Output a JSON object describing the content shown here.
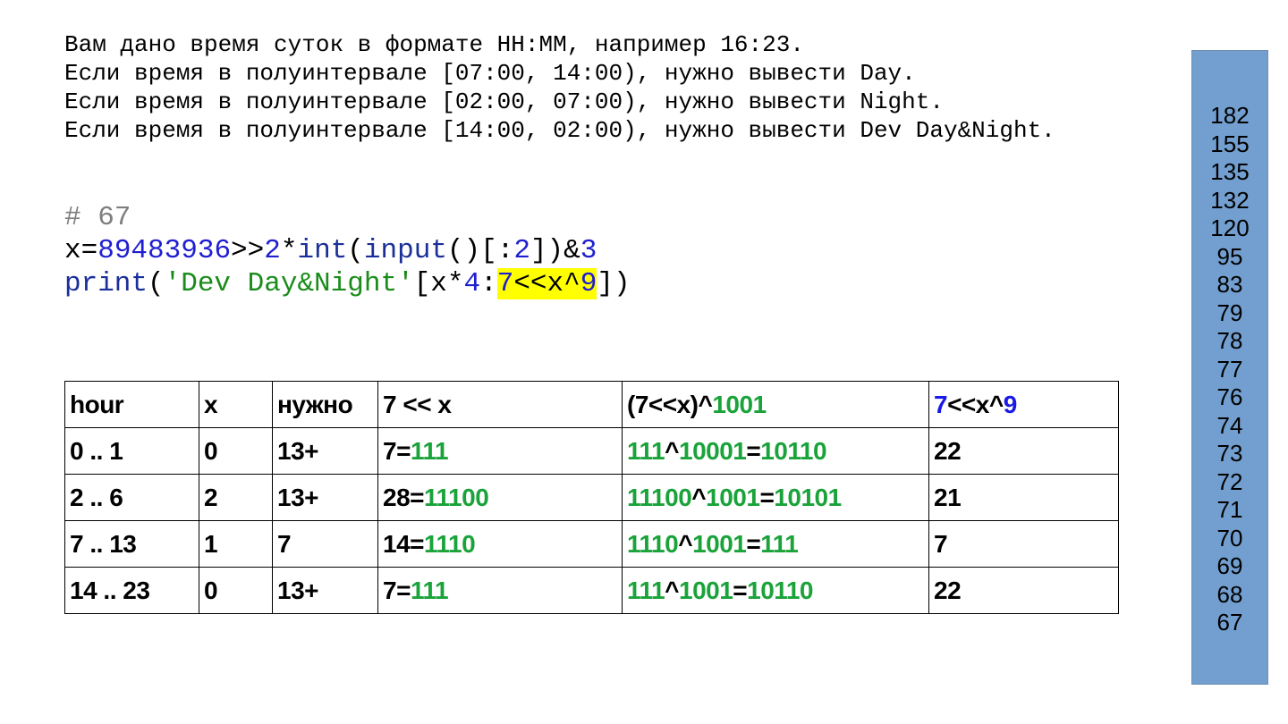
{
  "problem": {
    "lines": [
      "Вам дано время суток в формате HH:MM, например 16:23.",
      "Если время в полуинтервале [07:00, 14:00), нужно вывести Day.",
      "Если время в полуинтервале [02:00, 07:00), нужно вывести Night.",
      "Если время в полуинтервале [14:00, 02:00), нужно вывести Dev Day&Night."
    ]
  },
  "code": {
    "comment": "# 67",
    "line1": {
      "var": "x=",
      "n1": "89483936",
      "op1": ">>",
      "n2": "2",
      "op2": "*",
      "f_int": "int",
      "p1": "(",
      "f_input": "input",
      "p2": "()[:",
      "n3": "2",
      "p3": "])&",
      "n4": "3"
    },
    "line2": {
      "f_print": "print",
      "p1": "(",
      "str": "'Dev Day&Night'",
      "p2": "[x*",
      "n1": "4",
      "p3": ":",
      "hl_n": "7",
      "hl_op": "<<x^",
      "hl_n2": "9",
      "p4": "])"
    }
  },
  "table": {
    "header": {
      "hour": "hour",
      "x": "x",
      "need": "нужно",
      "shift": "7 << x",
      "xor_a": "(7<<x)^",
      "xor_b": "1001",
      "res_a": "7",
      "res_b": "<<x^",
      "res_c": "9"
    },
    "rows": [
      {
        "hour": "0 .. 1",
        "x": "0",
        "need": "13+",
        "dec": "7=",
        "bin": "111",
        "xa": "111",
        "xop": "^",
        "xb": "10001",
        "xeq": "=",
        "xc": "10110",
        "res": "22"
      },
      {
        "hour": "2 .. 6",
        "x": "2",
        "need": "13+",
        "dec": "28=",
        "bin": "11100",
        "xa": "11100",
        "xop": "^",
        "xb": "1001",
        "xeq": "=",
        "xc": "10101",
        "res": "21"
      },
      {
        "hour": "7 .. 13",
        "x": "1",
        "need": "7",
        "dec": "14=",
        "bin": "1110",
        "xa": "1110",
        "xop": "^",
        "xb": "1001",
        "xeq": "=",
        "xc": "111",
        "res": "7"
      },
      {
        "hour": "14 .. 23",
        "x": "0",
        "need": "13+",
        "dec": "7=",
        "bin": "111",
        "xa": "111",
        "xop": "^",
        "xb": "1001",
        "xeq": "=",
        "xc": "10110",
        "res": "22"
      }
    ]
  },
  "sidebar": {
    "values": [
      "182",
      "155",
      "135",
      "132",
      "120",
      "95",
      "83",
      "79",
      "78",
      "77",
      "76",
      "74",
      "73",
      "72",
      "71",
      "70",
      "69",
      "68",
      "67"
    ]
  },
  "colors": {
    "sidebar_bg": "#729fcf",
    "highlight": "#ffff00",
    "binary_green": "#1aa33a",
    "number_blue": "#1f1fd1",
    "string_green": "#1a8c1a",
    "comment_gray": "#7f7f7f"
  }
}
